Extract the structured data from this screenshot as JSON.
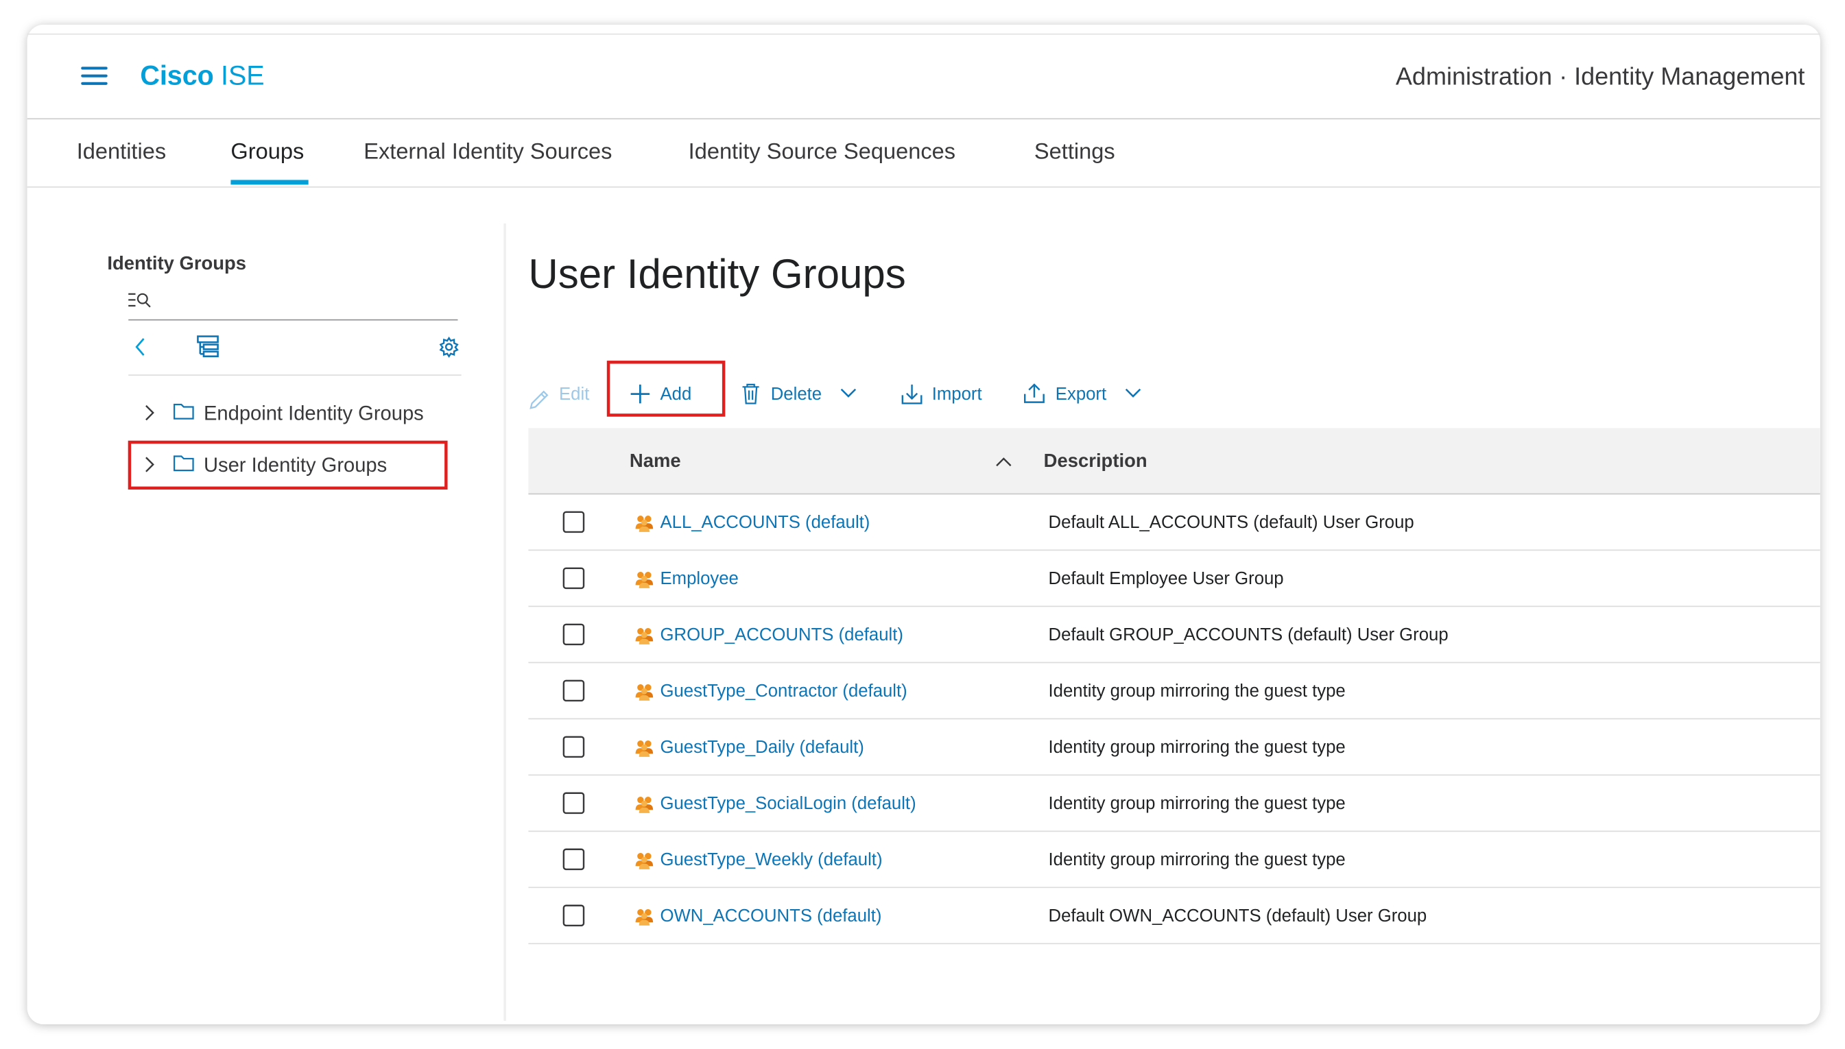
{
  "app": {
    "brand_bold": "Cisco",
    "brand_light": "ISE",
    "page_context": "Administration · Identity Management"
  },
  "tabs": [
    {
      "label": "Identities"
    },
    {
      "label": "Groups",
      "active": true
    },
    {
      "label": "External Identity Sources"
    },
    {
      "label": "Identity Source Sequences"
    },
    {
      "label": "Settings"
    }
  ],
  "sidebar": {
    "title": "Identity Groups",
    "search_icon": "filter-search-icon",
    "tree": [
      {
        "label": "Endpoint Identity Groups"
      },
      {
        "label": "User Identity Groups",
        "highlighted": true
      }
    ]
  },
  "main": {
    "title": "User Identity Groups",
    "toolbar": {
      "edit": "Edit",
      "add": "Add",
      "delete": "Delete",
      "import": "Import",
      "export": "Export"
    },
    "table": {
      "columns": [
        "Name",
        "Description"
      ],
      "rows": [
        {
          "name": "ALL_ACCOUNTS (default)",
          "description": "Default ALL_ACCOUNTS (default) User Group"
        },
        {
          "name": "Employee",
          "description": "Default Employee User Group"
        },
        {
          "name": "GROUP_ACCOUNTS (default)",
          "description": "Default GROUP_ACCOUNTS (default) User Group"
        },
        {
          "name": "GuestType_Contractor (default)",
          "description": "Identity group mirroring the guest type"
        },
        {
          "name": "GuestType_Daily (default)",
          "description": "Identity group mirroring the guest type"
        },
        {
          "name": "GuestType_SocialLogin (default)",
          "description": "Identity group mirroring the guest type"
        },
        {
          "name": "GuestType_Weekly (default)",
          "description": "Identity group mirroring the guest type"
        },
        {
          "name": "OWN_ACCOUNTS (default)",
          "description": "Default OWN_ACCOUNTS (default) User Group"
        }
      ]
    }
  },
  "colors": {
    "accent": "#049fd9",
    "link": "#0d74b5",
    "highlight": "#e01f1f",
    "group_icon": "#f0921f"
  }
}
